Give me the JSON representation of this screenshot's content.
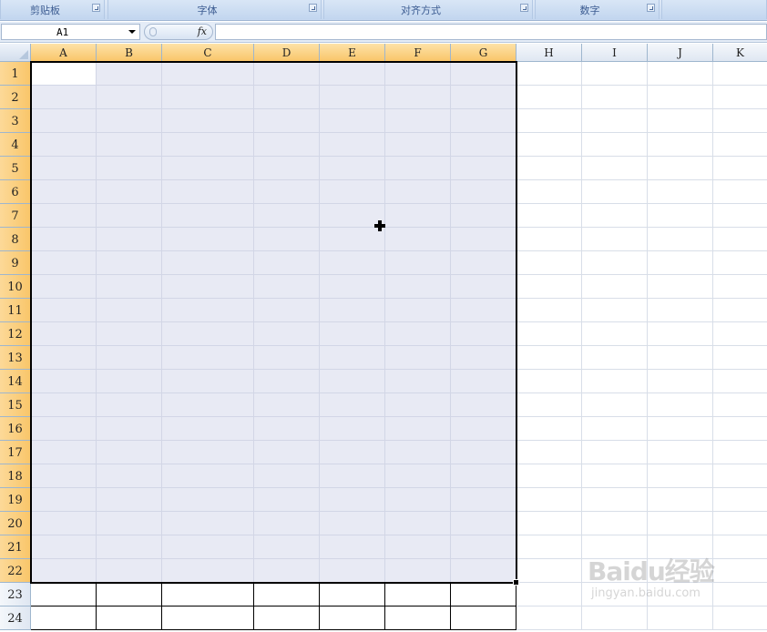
{
  "ribbon": {
    "groups": [
      {
        "label": "剪贴板"
      },
      {
        "label": "字体"
      },
      {
        "label": "对齐方式"
      },
      {
        "label": "数字"
      },
      {
        "label": ""
      }
    ]
  },
  "formula_bar": {
    "name_box": "A1",
    "fx_label": "fx",
    "formula": ""
  },
  "sheet": {
    "columns": [
      "A",
      "B",
      "C",
      "D",
      "E",
      "F",
      "G",
      "H",
      "I",
      "J",
      "K"
    ],
    "rows": [
      "1",
      "2",
      "3",
      "4",
      "5",
      "6",
      "7",
      "8",
      "9",
      "10",
      "11",
      "12",
      "13",
      "14",
      "15",
      "16",
      "17",
      "18",
      "19",
      "20",
      "21",
      "22",
      "23",
      "24"
    ],
    "selection": "A1:G22",
    "active_cell": "A1",
    "bordered_range": "A22:G24"
  },
  "watermark": {
    "logo": "Baidu经验",
    "url": "jingyan.baidu.com"
  },
  "colors": {
    "selection_fill": "#e8eaf4",
    "header_selected": "#f9c66a",
    "ribbon": "#c5d8f0"
  }
}
